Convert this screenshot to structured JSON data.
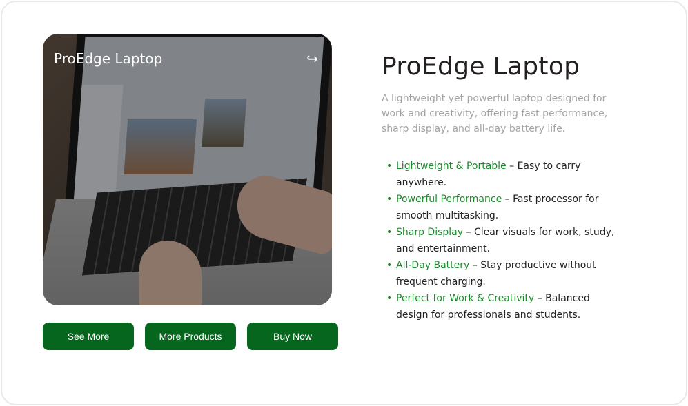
{
  "product": {
    "title": "ProEdge Laptop",
    "image_caption": "ProEdge Laptop",
    "share_icon": "share-arrow-icon",
    "description": "A lightweight yet powerful laptop designed for work and creativity, offering fast performance, sharp display, and all-day battery life."
  },
  "buttons": {
    "see_more": "See More",
    "more_products": "More Products",
    "buy_now": "Buy Now"
  },
  "features": [
    {
      "name": "Lightweight & Portable",
      "text": " – Easy to carry anywhere."
    },
    {
      "name": "Powerful Performance",
      "text": " – Fast processor for smooth multitasking."
    },
    {
      "name": "Sharp Display",
      "text": " – Clear visuals for work, study, and entertainment."
    },
    {
      "name": "All-Day Battery",
      "text": " – Stay productive without frequent charging."
    },
    {
      "name": "Perfect for Work & Creativity",
      "text": " – Balanced design for professionals and students."
    }
  ],
  "colors": {
    "accent": "#06661e",
    "feature": "#1a8a2a"
  }
}
